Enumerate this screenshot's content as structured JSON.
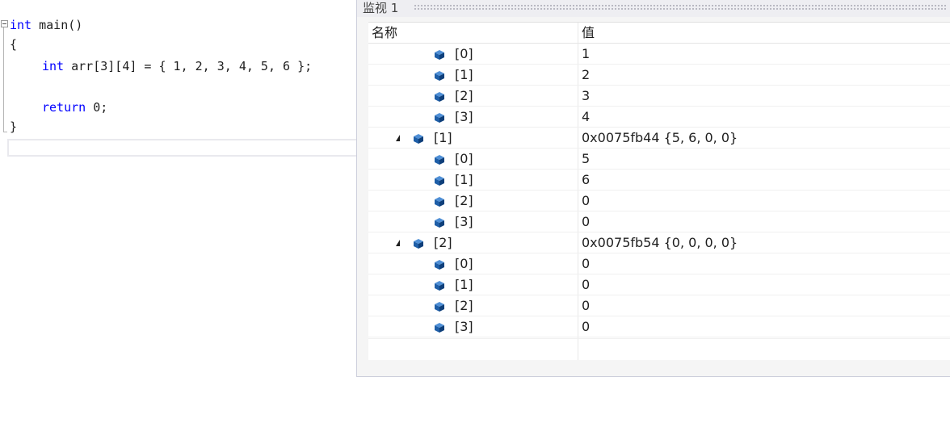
{
  "editor": {
    "lines": [
      {
        "kw": "int",
        "text": " main()"
      },
      {
        "kw": "",
        "text": "{"
      },
      {
        "kw": "int",
        "text": " arr[3][4] = { 1, 2, 3, 4, 5, 6 };"
      },
      {
        "kw": "return",
        "text": " 0;"
      },
      {
        "kw": "",
        "text": "}"
      }
    ]
  },
  "watch": {
    "title": "监视 1",
    "headers": {
      "name": "名称",
      "value": "值"
    },
    "rows": [
      {
        "name": "[0]",
        "value": "1",
        "expander": false,
        "indent": 1
      },
      {
        "name": "[1]",
        "value": "2",
        "expander": false,
        "indent": 1
      },
      {
        "name": "[2]",
        "value": "3",
        "expander": false,
        "indent": 1
      },
      {
        "name": "[3]",
        "value": "4",
        "expander": false,
        "indent": 1
      },
      {
        "name": "[1]",
        "value": "0x0075fb44 {5, 6, 0, 0}",
        "expander": true,
        "indent": 0
      },
      {
        "name": "[0]",
        "value": "5",
        "expander": false,
        "indent": 1
      },
      {
        "name": "[1]",
        "value": "6",
        "expander": false,
        "indent": 1
      },
      {
        "name": "[2]",
        "value": "0",
        "expander": false,
        "indent": 1
      },
      {
        "name": "[3]",
        "value": "0",
        "expander": false,
        "indent": 1
      },
      {
        "name": "[2]",
        "value": "0x0075fb54 {0, 0, 0, 0}",
        "expander": true,
        "indent": 0
      },
      {
        "name": "[0]",
        "value": "0",
        "expander": false,
        "indent": 1
      },
      {
        "name": "[1]",
        "value": "0",
        "expander": false,
        "indent": 1
      },
      {
        "name": "[2]",
        "value": "0",
        "expander": false,
        "indent": 1
      },
      {
        "name": "[3]",
        "value": "0",
        "expander": false,
        "indent": 1
      }
    ],
    "icon": "variable-cube-icon",
    "colors": {
      "keyword": "#0000ff",
      "cube": "#1f5fa8"
    }
  }
}
